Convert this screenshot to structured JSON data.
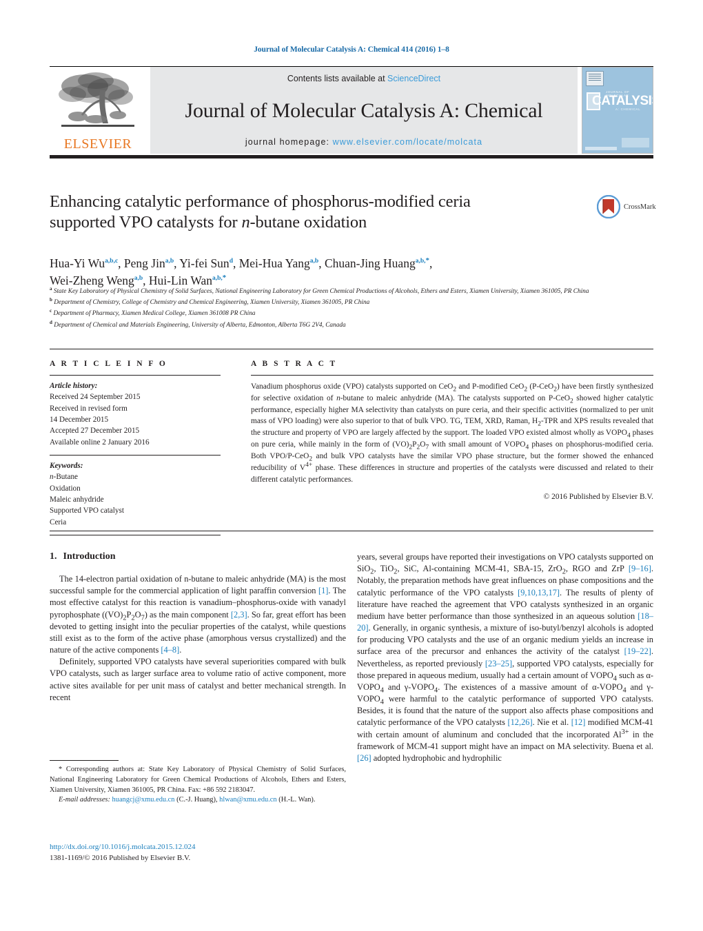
{
  "running_head": "Journal of Molecular Catalysis A: Chemical 414 (2016) 1–8",
  "masthead": {
    "contents_prefix": "Contents lists available at ",
    "sciencedirect": "ScienceDirect",
    "journal_title": "Journal of Molecular Catalysis A: Chemical",
    "homepage_prefix": "journal homepage: ",
    "homepage_url": "www.elsevier.com/locate/molcata",
    "publisher": "ELSEVIER",
    "cover_kicker": "JOURNAL OF MOLECULAR",
    "cover_word": "CATALYSIS",
    "cover_sub": "A: CHEMICAL",
    "accent_orange": "#E87722",
    "link_blue": "#3a9bd9",
    "cover_blue": "#9dc3de"
  },
  "article": {
    "title_line1": "Enhancing catalytic performance of phosphorus-modified ceria",
    "title_line2_a": "supported VPO catalysts for ",
    "title_line2_italic": "n",
    "title_line2_b": "-butane oxidation",
    "crossmark_label": "CrossMark",
    "authors": [
      {
        "name": "Hua-Yi Wu",
        "marks": "a,b,c",
        "sep": ", "
      },
      {
        "name": "Peng Jin",
        "marks": "a,b",
        "sep": ", "
      },
      {
        "name": "Yi-fei Sun",
        "marks": "d",
        "sep": ", "
      },
      {
        "name": "Mei-Hua Yang",
        "marks": "a,b",
        "sep": ", "
      },
      {
        "name": "Chuan-Jing Huang",
        "marks": "a,b,*",
        "sep": ", "
      },
      {
        "name": "Wei-Zheng Weng",
        "marks": "a,b",
        "sep": ", "
      },
      {
        "name": "Hui-Lin Wan",
        "marks": "a,b,*",
        "sep": ""
      }
    ],
    "affiliations": [
      {
        "mark": "a",
        "text": "State Key Laboratory of Physical Chemistry of Solid Surfaces, National Engineering Laboratory for Green Chemical Productions of Alcohols, Ethers and Esters, Xiamen University, Xiamen 361005, PR China"
      },
      {
        "mark": "b",
        "text": "Department of Chemistry, College of Chemistry and Chemical Engineering, Xiamen University, Xiamen 361005, PR China"
      },
      {
        "mark": "c",
        "text": "Department of Pharmacy, Xiamen Medical College, Xiamen 361008 PR China"
      },
      {
        "mark": "d",
        "text": "Department of Chemical and Materials Engineering, University of Alberta, Edmonton, Alberta T6G 2V4, Canada"
      }
    ]
  },
  "article_info": {
    "heading": "A R T I C L E   I N F O",
    "history_label": "Article history:",
    "history": [
      "Received 24 September 2015",
      "Received in revised form",
      "14 December 2015",
      "Accepted 27 December 2015",
      "Available online 2 January 2016"
    ],
    "keywords_label": "Keywords:",
    "keywords": [
      "n-Butane",
      "Oxidation",
      "Maleic anhydride",
      "Supported VPO catalyst",
      "Ceria"
    ]
  },
  "abstract": {
    "heading": "A B S T R A C T",
    "copyright": "© 2016 Published by Elsevier B.V.",
    "text_parts": [
      "Vanadium phosphorus oxide (VPO) catalysts supported on CeO",
      "2",
      " and P-modified CeO",
      "2",
      " (P-CeO",
      "2",
      ") have been firstly synthesized for selective oxidation of ",
      "n",
      "-butane to maleic anhydride (MA). The catalysts supported on P-CeO",
      "2",
      " showed higher catalytic performance, especially higher MA selectivity than catalysts on pure ceria, and their specific activities (normalized to per unit mass of VPO loading) were also superior to that of bulk VPO. TG, TEM, XRD, Raman, H",
      "2",
      "-TPR and XPS results revealed that the structure and property of VPO are largely affected by the support. The loaded VPO existed almost wholly as VOPO",
      "4",
      " phases on pure ceria, while mainly in the form of (VO)",
      "2",
      "P",
      "2",
      "O",
      "7",
      " with small amount of VOPO",
      "4",
      " phases on phosphorus-modified ceria. Both VPO/P-CeO",
      "2",
      " and bulk VPO catalysts have the similar VPO phase structure, but the former showed the enhanced reducibility of V",
      "4+",
      " phase. These differences in structure and properties of the catalysts were discussed and related to their different catalytic performances."
    ]
  },
  "introduction": {
    "number": "1.",
    "title": "Introduction",
    "left_paragraphs": [
      "The 14-electron partial oxidation of n-butane to maleic anhydride (MA) is the most successful sample for the commercial application of light paraffin conversion [1]. The most effective catalyst for this reaction is vanadium–phosphorus-oxide with vanadyl pyrophosphate ((VO)2P2O7) as the main component [2,3]. So far, great effort has been devoted to getting insight into the peculiar properties of the catalyst, while questions still exist as to the form of the active phase (amorphous versus crystallized) and the nature of the active components [4–8].",
      "Definitely, supported VPO catalysts have several superiorities compared with bulk VPO catalysts, such as larger surface area to volume ratio of active component, more active sites available for per unit mass of catalyst and better mechanical strength. In recent"
    ],
    "right_paragraph": "years, several groups have reported their investigations on VPO catalysts supported on SiO2, TiO2, SiC, Al-containing MCM-41, SBA-15, ZrO2, RGO and ZrP [9–16]. Notably, the preparation methods have great influences on phase compositions and the catalytic performance of the VPO catalysts [9,10,13,17]. The results of plenty of literature have reached the agreement that VPO catalysts synthesized in an organic medium have better performance than those synthesized in an aqueous solution [18–20]. Generally, in organic synthesis, a mixture of iso-butyl/benzyl alcohols is adopted for producing VPO catalysts and the use of an organic medium yields an increase in surface area of the precursor and enhances the activity of the catalyst [19–22]. Nevertheless, as reported previously [23–25], supported VPO catalysts, especially for those prepared in aqueous medium, usually had a certain amount of VOPO4 such as α-VOPO4 and γ-VOPO4. The existences of a massive amount of α-VOPO4 and γ-VOPO4 were harmful to the catalytic performance of supported VPO catalysts. Besides, it is found that the nature of the support also affects phase compositions and catalytic performance of the VPO catalysts [12,26]. Nie et al. [12] modified MCM-41 with certain amount of aluminum and concluded that the incorporated Al3+ in the framework of MCM-41 support might have an impact on MA selectivity. Buena et al. [26] adopted hydrophobic and hydrophilic"
  },
  "footnotes": {
    "corresponding": "* Corresponding authors at: State Key Laboratory of Physical Chemistry of Solid Surfaces, National Engineering Laboratory for Green Chemical Productions of Alcohols, Ethers and Esters, Xiamen University, Xiamen 361005, PR China. Fax: +86 592 2183047.",
    "email_label": "E-mail addresses:",
    "email1": "huangcj@xmu.edu.cn",
    "email1_owner": "(C.-J. Huang),",
    "email2": "hlwan@xmu.edu.cn",
    "email2_owner": "(H.-L. Wan).",
    "doi": "http://dx.doi.org/10.1016/j.molcata.2015.12.024",
    "issn_line": "1381-1169/© 2016 Published by Elsevier B.V."
  }
}
